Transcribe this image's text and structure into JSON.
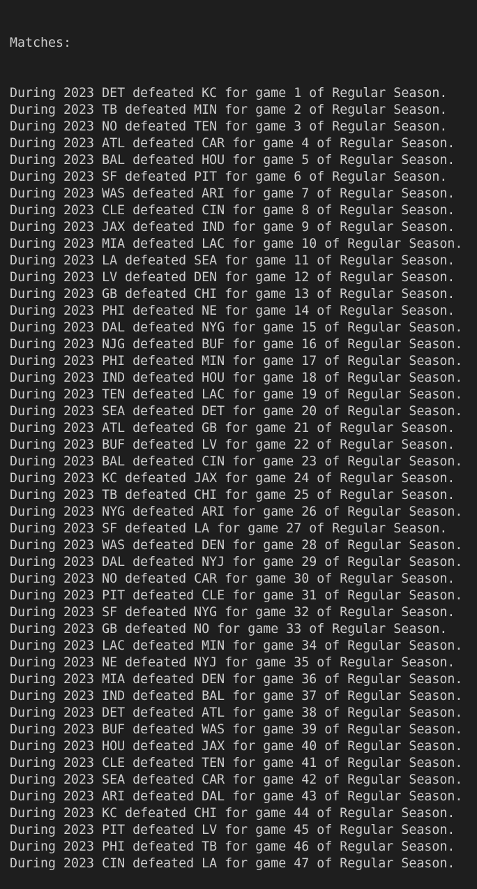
{
  "terminal": {
    "header": "Matches:",
    "lines": [
      "During 2023 DET defeated KC for game 1 of Regular Season.",
      "During 2023 TB defeated MIN for game 2 of Regular Season.",
      "During 2023 NO defeated TEN for game 3 of Regular Season.",
      "During 2023 ATL defeated CAR for game 4 of Regular Season.",
      "During 2023 BAL defeated HOU for game 5 of Regular Season.",
      "During 2023 SF defeated PIT for game 6 of Regular Season.",
      "During 2023 WAS defeated ARI for game 7 of Regular Season.",
      "During 2023 CLE defeated CIN for game 8 of Regular Season.",
      "During 2023 JAX defeated IND for game 9 of Regular Season.",
      "During 2023 MIA defeated LAC for game 10 of Regular Season.",
      "During 2023 LA defeated SEA for game 11 of Regular Season.",
      "During 2023 LV defeated DEN for game 12 of Regular Season.",
      "During 2023 GB defeated CHI for game 13 of Regular Season.",
      "During 2023 PHI defeated NE for game 14 of Regular Season.",
      "During 2023 DAL defeated NYG for game 15 of Regular Season.",
      "During 2023 NJG defeated BUF for game 16 of Regular Season.",
      "During 2023 PHI defeated MIN for game 17 of Regular Season.",
      "During 2023 IND defeated HOU for game 18 of Regular Season.",
      "During 2023 TEN defeated LAC for game 19 of Regular Season.",
      "During 2023 SEA defeated DET for game 20 of Regular Season.",
      "During 2023 ATL defeated GB for game 21 of Regular Season.",
      "During 2023 BUF defeated LV for game 22 of Regular Season.",
      "During 2023 BAL defeated CIN for game 23 of Regular Season.",
      "During 2023 KC defeated JAX for game 24 of Regular Season.",
      "During 2023 TB defeated CHI for game 25 of Regular Season.",
      "During 2023 NYG defeated ARI for game 26 of Regular Season.",
      "During 2023 SF defeated LA for game 27 of Regular Season.",
      "During 2023 WAS defeated DEN for game 28 of Regular Season.",
      "During 2023 DAL defeated NYJ for game 29 of Regular Season.",
      "During 2023 NO defeated CAR for game 30 of Regular Season.",
      "During 2023 PIT defeated CLE for game 31 of Regular Season.",
      "During 2023 SF defeated NYG for game 32 of Regular Season.",
      "During 2023 GB defeated NO for game 33 of Regular Season.",
      "During 2023 LAC defeated MIN for game 34 of Regular Season.",
      "During 2023 NE defeated NYJ for game 35 of Regular Season.",
      "During 2023 MIA defeated DEN for game 36 of Regular Season.",
      "During 2023 IND defeated BAL for game 37 of Regular Season.",
      "During 2023 DET defeated ATL for game 38 of Regular Season.",
      "During 2023 BUF defeated WAS for game 39 of Regular Season.",
      "During 2023 HOU defeated JAX for game 40 of Regular Season.",
      "During 2023 CLE defeated TEN for game 41 of Regular Season.",
      "During 2023 SEA defeated CAR for game 42 of Regular Season.",
      "During 2023 ARI defeated DAL for game 43 of Regular Season.",
      "During 2023 KC defeated CHI for game 44 of Regular Season.",
      "During 2023 PIT defeated LV for game 45 of Regular Season.",
      "During 2023 PHI defeated TB for game 46 of Regular Season.",
      "During 2023 CIN defeated LA for game 47 of Regular Season."
    ]
  },
  "colors": {
    "background": "#1e1e1e",
    "text": "#cccccc"
  }
}
